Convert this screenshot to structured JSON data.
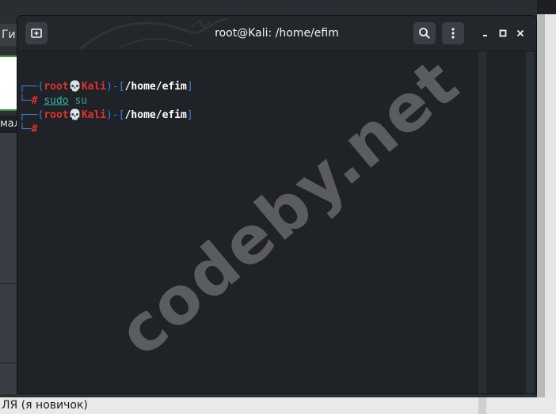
{
  "background": {
    "tab_label": "ГиБ",
    "side_label": "мал",
    "status_text": "ЛЯ (я новичок)"
  },
  "terminal": {
    "title": "root@Kali: /home/efim",
    "icons": {
      "new_tab": "new-tab-icon",
      "search": "search-icon",
      "menu": "kebab-menu-icon",
      "minimize": "minimize-icon",
      "maximize": "maximize-icon",
      "close": "close-icon"
    },
    "lines": [
      {
        "user": "root",
        "skull": "💀",
        "host": "Kali",
        "path": "/home/efim"
      },
      {
        "prompt": "#",
        "command": "sudo",
        "args": " su"
      },
      {
        "user": "root",
        "skull": "💀",
        "host": "Kali",
        "path": "/home/efim"
      },
      {
        "prompt": "#"
      }
    ]
  },
  "watermark": "codeby.net",
  "colors": {
    "prompt_bracket": "#3d7dd8",
    "user_host": "#e4312b",
    "command": "#37b2a4"
  }
}
